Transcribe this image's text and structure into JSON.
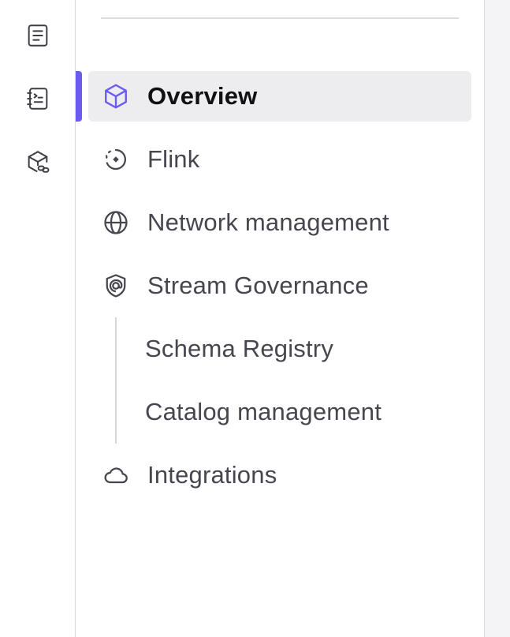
{
  "rail": {
    "icons": [
      "document-icon",
      "notebook-icon",
      "package-link-icon"
    ]
  },
  "nav": {
    "items": [
      {
        "label": "Overview",
        "icon": "cube-icon",
        "active": true
      },
      {
        "label": "Flink",
        "icon": "flink-rotate-icon"
      },
      {
        "label": "Network management",
        "icon": "globe-icon"
      },
      {
        "label": "Stream Governance",
        "icon": "shield-icon"
      },
      {
        "label": "Integrations",
        "icon": "cloud-icon"
      }
    ],
    "sub_items": [
      {
        "label": "Schema Registry"
      },
      {
        "label": "Catalog management"
      }
    ]
  },
  "colors": {
    "accent": "#6b5bf1",
    "active_bg": "#ededf0",
    "text": "#46464f"
  }
}
